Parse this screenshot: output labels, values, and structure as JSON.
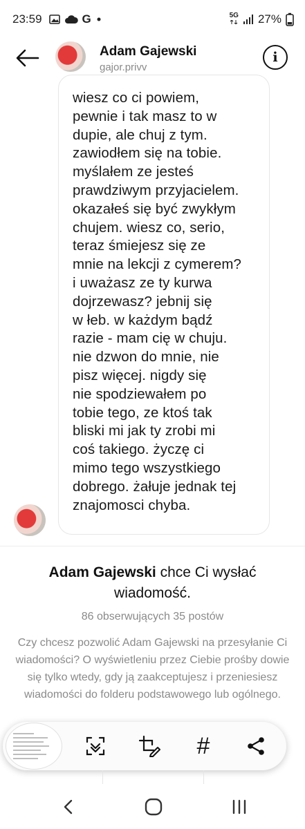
{
  "status_bar": {
    "time": "23:59",
    "left_icons": [
      "image-icon",
      "cloud-icon",
      "google-icon",
      "dot-icon"
    ],
    "google_letter": "G",
    "network": "5G",
    "battery": "27%"
  },
  "header": {
    "name": "Adam Gajewski",
    "handle": "gajor.privv",
    "info_label": "i"
  },
  "message": {
    "text": "wiesz co ci powiem,\npewnie i tak masz to w\ndupie, ale chuj z tym.\nzawiodłem się na tobie.\nmyślałem ze jesteś\nprawdziwym przyjacielem.\nokazałeś się być zwykłym\nchujem. wiesz co, serio,\nteraz śmiejesz się ze\nmnie na lekcji z cymerem?\ni uważasz ze ty kurwa\ndojrzewasz? jebnij się\nw łeb. w każdym bądź\nrazie - mam cię w chuju.\nnie dzwon do mnie, nie\npisz więcej. nigdy się\nnie spodziewałem po\ntobie tego, ze ktoś tak\nbliski mi jak ty zrobi mi\ncoś takiego. życzę ci\nmimo tego wszystkiego\ndobrego. żałuje jednak tej\nznajomosci chyba."
  },
  "request": {
    "name": "Adam Gajewski",
    "title_rest": " chce Ci wysłać wiadomość.",
    "stats": "86 obserwujących 35 postów",
    "body": "Czy chcesz pozwolić Adam Gajewski na przesyłanie Ci wiadomości? O wyświetleniu przez Ciebie prośby dowie się tylko wtedy, gdy ją zaakceptujesz i przeniesiesz wiadomości do folderu podstawowego lub ogólnego."
  },
  "toolbar": {
    "buttons": [
      "scan-text-icon",
      "edit-crop-icon",
      "hashtag-icon",
      "share-icon"
    ],
    "hashtag_glyph": "#"
  },
  "nav_bar": {
    "buttons": [
      "back-nav-icon",
      "home-nav-icon",
      "recents-nav-icon"
    ]
  }
}
